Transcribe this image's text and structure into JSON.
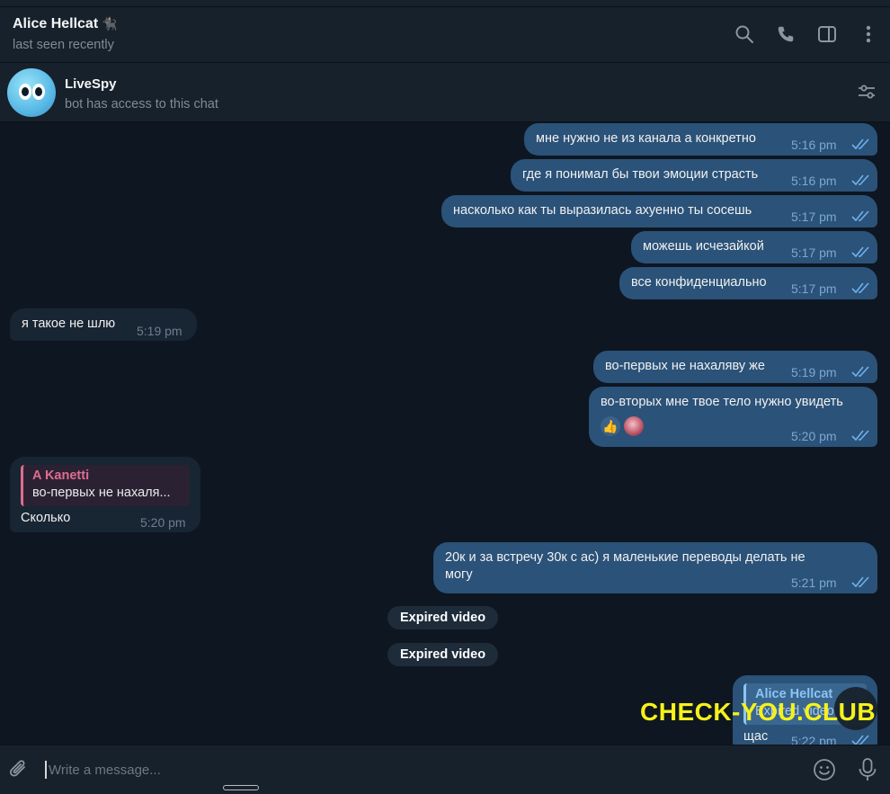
{
  "header": {
    "name": "Alice Hellcat",
    "cat_emoji": "🐈‍⬛",
    "status": "last seen recently"
  },
  "bot": {
    "name": "LiveSpy",
    "subtitle": "bot has access to this chat"
  },
  "messages": [
    {
      "text": "мне нужно не из канала а конкретно",
      "time": "5:16 pm"
    },
    {
      "text": "где я понимал бы твои эмоции страсть",
      "time": "5:16 pm"
    },
    {
      "text": "насколько как ты выразилась ахуенно ты сосешь",
      "time": "5:17 pm"
    },
    {
      "text": "можешь исчезайкой",
      "time": "5:17 pm"
    },
    {
      "text": "все конфиденциально",
      "time": "5:17 pm"
    },
    {
      "text": "я такое не шлю",
      "time": "5:19 pm"
    },
    {
      "text": "во-первых не нахаляву же",
      "time": "5:19 pm"
    },
    {
      "text": "во-вторых мне твое тело нужно увидеть",
      "time": "5:20 pm",
      "reaction": "👍"
    },
    {
      "reply_name": "A Kanetti",
      "reply_text": "во-первых не нахаля...",
      "text": "Сколько",
      "time": "5:20 pm"
    },
    {
      "text": "20к и за встречу 30к с ас) я маленькие переводы делать не могу",
      "time": "5:21 pm"
    },
    {
      "reply_name": "Alice Hellcat",
      "reply_text": "Expired video",
      "text": "щас",
      "time": "5:22 pm"
    }
  ],
  "service": [
    "Expired video",
    "Expired video"
  ],
  "input": {
    "placeholder": "Write a message..."
  },
  "watermark": "CHECK-YOU.CLUB",
  "colors": {
    "background": "#0e1621",
    "panel": "#17212b",
    "outgoing": "#2b5278",
    "incoming": "#182533",
    "accent": "#8cc4f5"
  }
}
